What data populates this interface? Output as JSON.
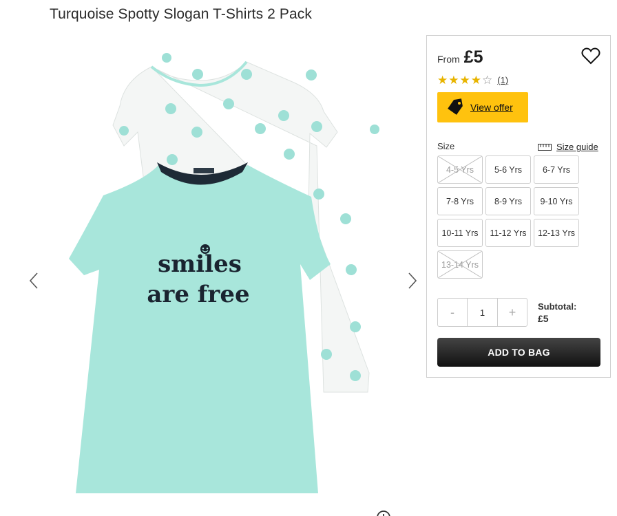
{
  "product": {
    "title": "Turquoise Spotty Slogan T-Shirts 2 Pack",
    "image_print_text": "smiles are free"
  },
  "price": {
    "from_label": "From",
    "value": "£5"
  },
  "rating": {
    "stars": 4,
    "max_stars": 5,
    "review_count": "(1)"
  },
  "offer": {
    "label": "View offer",
    "color": "#ffc20e"
  },
  "size": {
    "label": "Size",
    "guide_label": "Size guide",
    "options": [
      {
        "label": "4-5 Yrs",
        "available": false
      },
      {
        "label": "5-6 Yrs",
        "available": true
      },
      {
        "label": "6-7 Yrs",
        "available": true
      },
      {
        "label": "7-8 Yrs",
        "available": true
      },
      {
        "label": "8-9 Yrs",
        "available": true
      },
      {
        "label": "9-10 Yrs",
        "available": true
      },
      {
        "label": "10-11 Yrs",
        "available": true
      },
      {
        "label": "11-12 Yrs",
        "available": true
      },
      {
        "label": "12-13 Yrs",
        "available": true
      },
      {
        "label": "13-14 Yrs",
        "available": false
      }
    ]
  },
  "quantity": {
    "minus": "-",
    "value": "1",
    "plus": "+"
  },
  "subtotal": {
    "label": "Subtotal:",
    "value": "£5"
  },
  "add_to_bag": {
    "label": "ADD TO BAG"
  },
  "icons": {
    "prev": "chevron-left-icon",
    "next": "chevron-right-icon",
    "wishlist": "heart-icon",
    "offer": "tag-icon",
    "size_guide": "ruler-icon",
    "zoom": "zoom-icon"
  },
  "colors": {
    "mint": "#a8e6db",
    "dots": "#9ee0d6",
    "white_tee": "#f4f6f5",
    "button_dark": "#1c1c1c",
    "star": "#e8b400"
  }
}
